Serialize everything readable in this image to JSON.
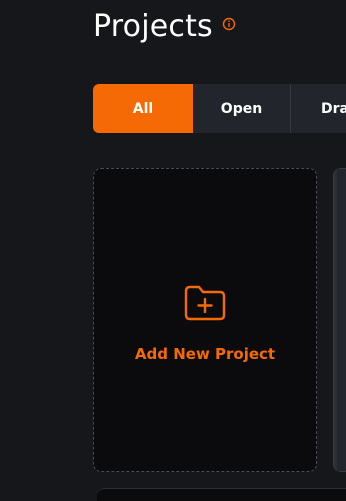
{
  "page": {
    "title": "Projects",
    "info_icon": "info-icon"
  },
  "tabs": [
    {
      "label": "All",
      "active": true
    },
    {
      "label": "Open",
      "active": false
    },
    {
      "label": "Dra",
      "active": false
    }
  ],
  "add_card": {
    "label": "Add New Project",
    "icon": "folder-plus-icon"
  },
  "colors": {
    "accent": "#f66a05",
    "background": "#16171b",
    "card": "#0b0b0d",
    "tab": "#22252c"
  }
}
